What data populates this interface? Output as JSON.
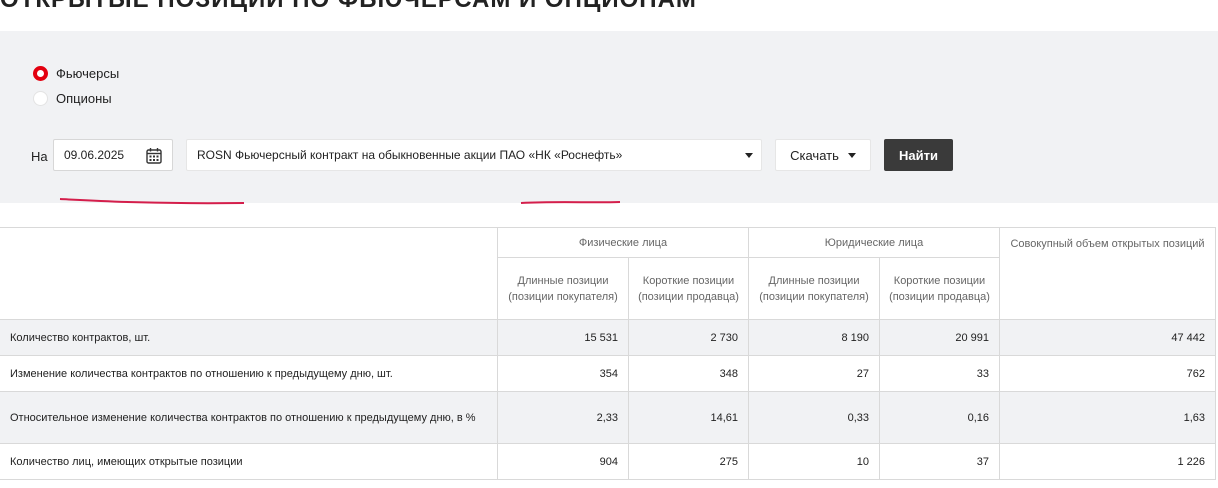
{
  "page": {
    "title": "ОТКРЫТЫЕ ПОЗИЦИИ ПО ФЬЮЧЕРСАМ И ОПЦИОНАМ"
  },
  "filters": {
    "instrument_type": {
      "options": [
        {
          "label": "Фьючерсы",
          "checked": true
        },
        {
          "label": "Опционы",
          "checked": false
        }
      ]
    },
    "date_prefix": "На",
    "date_value": "09.06.2025",
    "contract_value": "ROSN Фьючерсный контракт на обыкновенные акции ПАО «НК «Роснефть»",
    "download_label": "Скачать",
    "find_label": "Найти"
  },
  "colors": {
    "accent_red": "#e3000f",
    "panel_bg": "#f1f2f4",
    "find_button_bg": "#3a3a3a",
    "annotation_underline": "#d41e4b"
  },
  "table": {
    "group_headers": {
      "individuals": "Физические лица",
      "legal_entities": "Юридические лица",
      "total": "Совокупный объем открытых позиций"
    },
    "sub_headers": {
      "long": "Длинные позиции (позиции покупателя)",
      "short": "Короткие позиции (позиции продавца)"
    },
    "rows": [
      {
        "label": "Количество контрактов, шт.",
        "ind_long": "15 531",
        "ind_short": "2 730",
        "leg_long": "8 190",
        "leg_short": "20 991",
        "total": "47 442"
      },
      {
        "label": "Изменение количества контрактов по отношению к предыдущему дню, шт.",
        "ind_long": "354",
        "ind_short": "348",
        "leg_long": "27",
        "leg_short": "33",
        "total": "762"
      },
      {
        "label": "Относительное изменение количества контрактов по отношению к предыдущему дню, в %",
        "ind_long": "2,33",
        "ind_short": "14,61",
        "leg_long": "0,33",
        "leg_short": "0,16",
        "total": "1,63"
      },
      {
        "label": "Количество лиц, имеющих открытые позиции",
        "ind_long": "904",
        "ind_short": "275",
        "leg_long": "10",
        "leg_short": "37",
        "total": "1 226"
      }
    ]
  }
}
